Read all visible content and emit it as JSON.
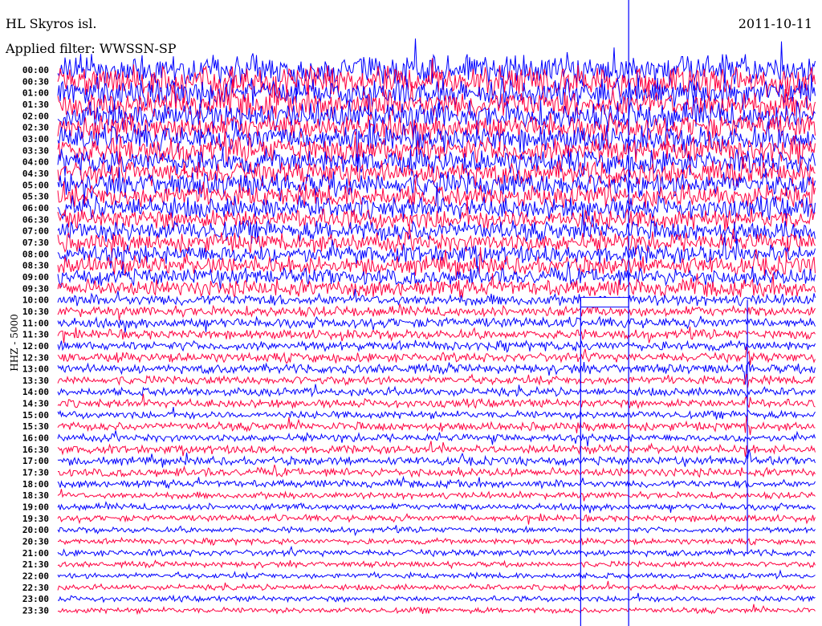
{
  "header": {
    "station": "HL Skyros isl.",
    "date": "2011-10-11",
    "filter": "Applied filter: WWSSN-SP"
  },
  "chart_data": {
    "type": "helicorder",
    "ylabel": "HHZ - 5000",
    "row_labels": [
      "00:00",
      "00:30",
      "01:00",
      "01:30",
      "02:00",
      "02:30",
      "03:00",
      "03:30",
      "04:00",
      "04:30",
      "05:00",
      "05:30",
      "06:00",
      "06:30",
      "07:00",
      "07:30",
      "08:00",
      "08:30",
      "09:00",
      "09:30",
      "10:00",
      "10:30",
      "11:00",
      "11:30",
      "12:00",
      "12:30",
      "13:00",
      "13:30",
      "14:00",
      "14:30",
      "15:00",
      "15:30",
      "16:00",
      "16:30",
      "17:00",
      "17:30",
      "18:00",
      "18:30",
      "19:00",
      "19:30",
      "20:00",
      "20:30",
      "21:00",
      "21:30",
      "22:00",
      "22:30",
      "23:00",
      "23:30"
    ],
    "row_minutes": 30,
    "relative_amplitude": [
      1.6,
      1.6,
      1.5,
      1.5,
      1.5,
      1.4,
      1.4,
      1.4,
      1.3,
      1.3,
      1.3,
      1.2,
      1.2,
      1.1,
      1.1,
      1.0,
      1.0,
      1.0,
      0.9,
      0.9,
      0.6,
      0.55,
      0.55,
      0.5,
      0.5,
      0.5,
      0.5,
      0.45,
      0.45,
      0.45,
      0.4,
      0.45,
      0.4,
      0.45,
      0.45,
      0.45,
      0.4,
      0.35,
      0.35,
      0.35,
      0.3,
      0.3,
      0.35,
      0.3,
      0.3,
      0.3,
      0.3,
      0.3
    ],
    "colors": {
      "even": "#0000ff",
      "odd": "#ff0040",
      "marker": "#0000ff"
    },
    "data_gap": {
      "row": "10:00",
      "minute_start": 20.7,
      "minute_end": 22.6
    },
    "event_markers_minutes": [
      20.7,
      22.6,
      27.3
    ],
    "events": [
      {
        "row": "12:30",
        "minute": 27.3,
        "duration_rows": 10
      }
    ]
  }
}
